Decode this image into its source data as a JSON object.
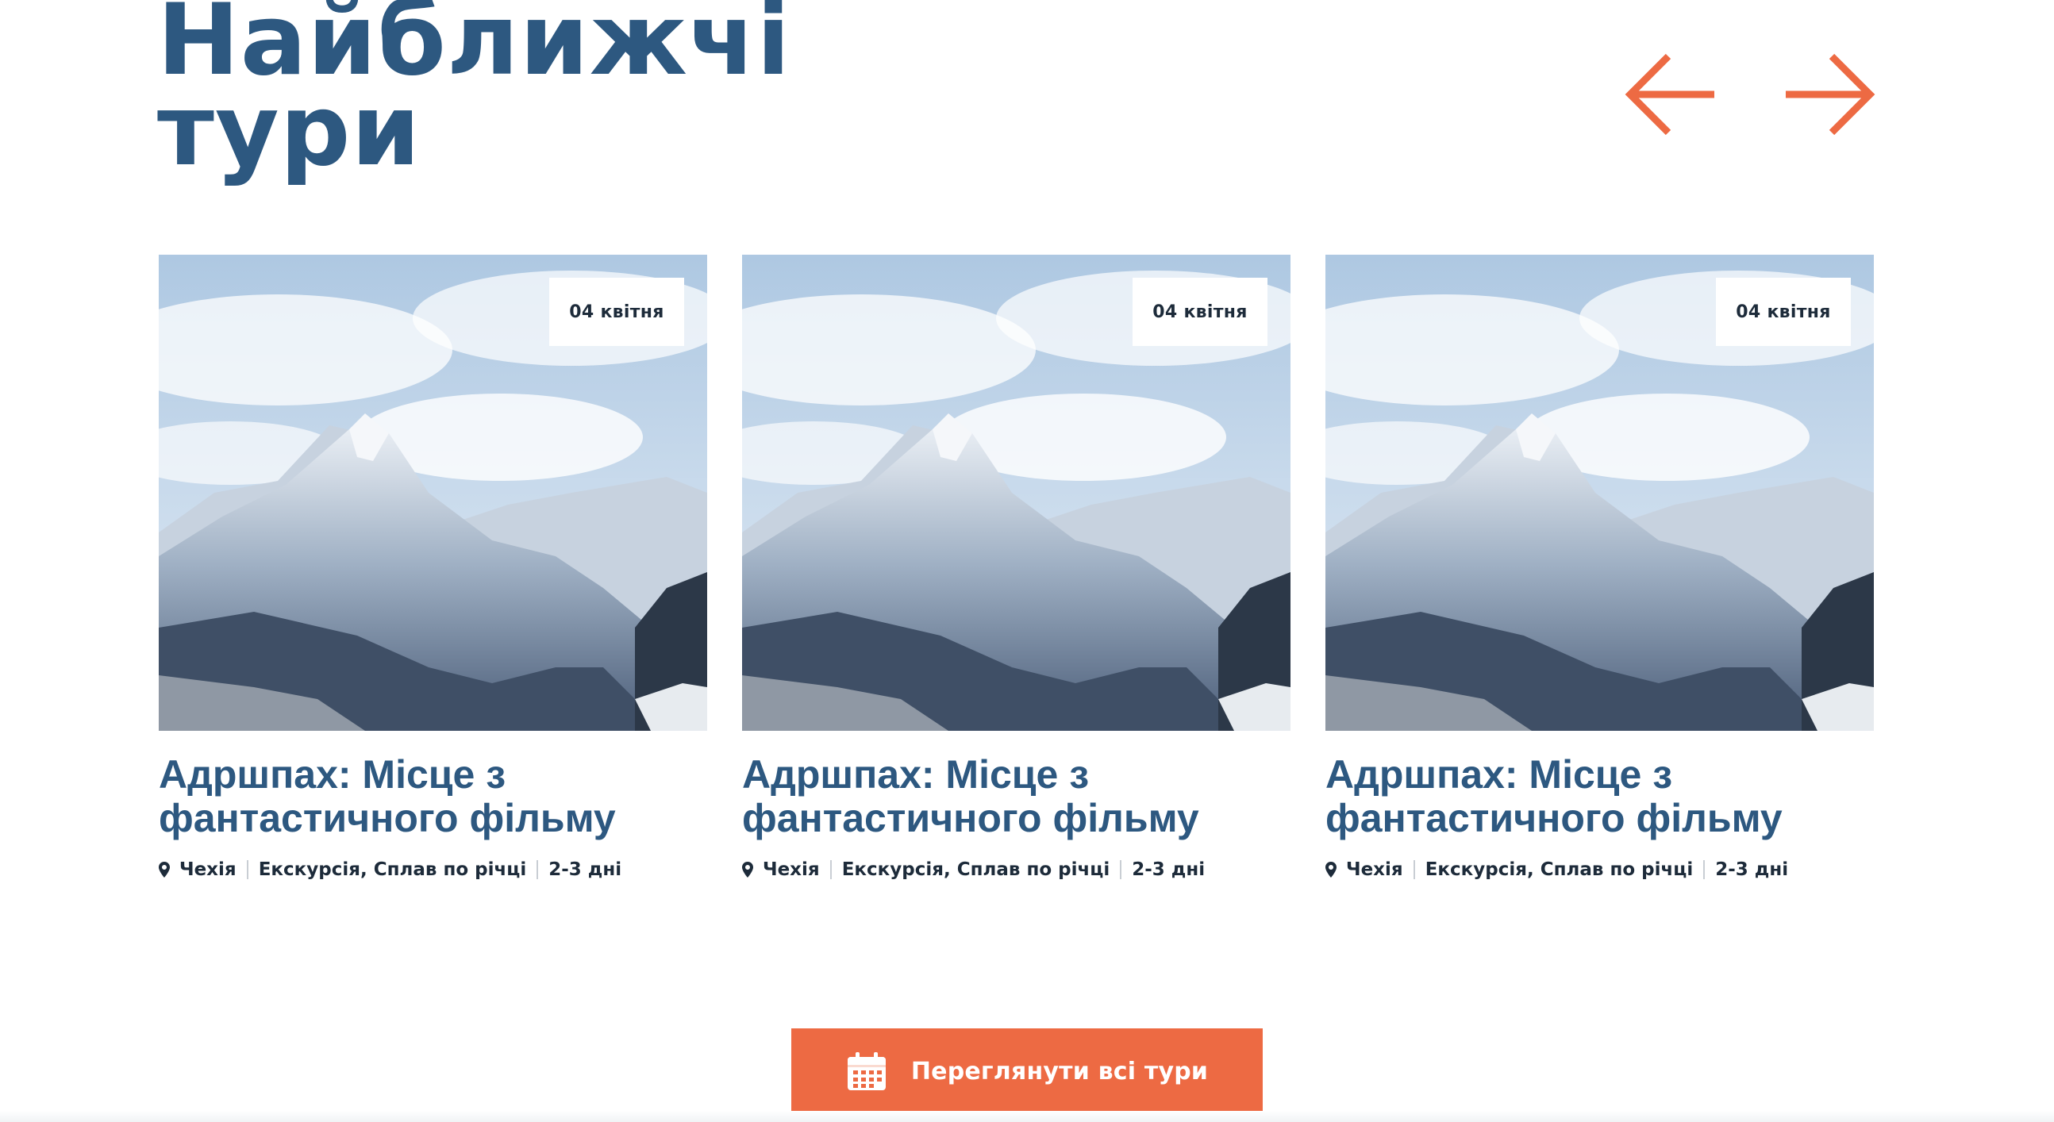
{
  "section": {
    "title_line1": "Найближчі",
    "title_line2": "тури"
  },
  "nav": {
    "prev_icon": "arrow-left-icon",
    "next_icon": "arrow-right-icon",
    "arrow_color": "#ed6a43"
  },
  "cards": [
    {
      "date": "04 квітня",
      "title": "Адршпах: Місце з фантастичного фільму",
      "location": "Чехія",
      "type": "Екскурсія, Сплав по річці",
      "duration": "2-3 дні"
    },
    {
      "date": "04 квітня",
      "title": "Адршпах: Місце з фантастичного фільму",
      "location": "Чехія",
      "type": "Екскурсія, Сплав по річці",
      "duration": "2-3 дні"
    },
    {
      "date": "04 квітня",
      "title": "Адршпах: Місце з фантастичного фільму",
      "location": "Чехія",
      "type": "Екскурсія, Сплав по річці",
      "duration": "2-3 дні"
    }
  ],
  "cta": {
    "label": "Переглянути всі тури",
    "icon": "calendar-icon"
  },
  "colors": {
    "title": "#2d5880",
    "accent": "#ed6a43",
    "text_dark": "#1d2b3a"
  }
}
